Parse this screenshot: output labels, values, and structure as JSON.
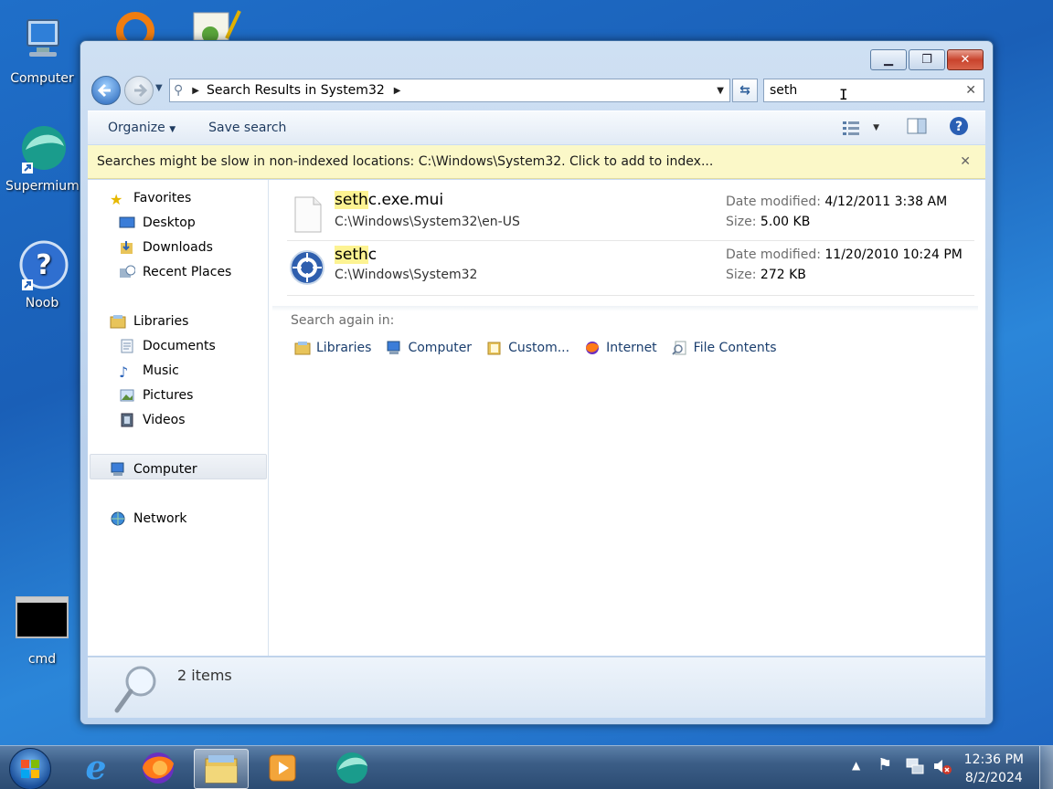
{
  "desktop": {
    "icons": [
      {
        "label": "Computer"
      },
      {
        "label": "Supermium"
      },
      {
        "label": "Noob"
      },
      {
        "label": "cmd"
      }
    ]
  },
  "window": {
    "address": {
      "path": "Search Results in System32"
    },
    "search": {
      "value": "seth"
    },
    "toolbar": {
      "organize": "Organize",
      "save_search": "Save search"
    },
    "infobar": {
      "text": "Searches might be slow in non-indexed locations: C:\\Windows\\System32. Click to add to index..."
    },
    "nav": {
      "favorites": "Favorites",
      "desktop": "Desktop",
      "downloads": "Downloads",
      "recent_places": "Recent Places",
      "libraries": "Libraries",
      "documents": "Documents",
      "music": "Music",
      "pictures": "Pictures",
      "videos": "Videos",
      "computer": "Computer",
      "network": "Network"
    },
    "results": [
      {
        "name_match": "seth",
        "name_rest": "c.exe.mui",
        "path": "C:\\Windows\\System32\\en-US",
        "date_label": "Date modified:",
        "date": "4/12/2011 3:38 AM",
        "size_label": "Size:",
        "size": "5.00 KB"
      },
      {
        "name_match": "seth",
        "name_rest": "c",
        "path": "C:\\Windows\\System32",
        "date_label": "Date modified:",
        "date": "11/20/2010 10:24 PM",
        "size_label": "Size:",
        "size": "272 KB"
      }
    ],
    "search_again": {
      "label": "Search again in:",
      "items": [
        "Libraries",
        "Computer",
        "Custom...",
        "Internet",
        "File Contents"
      ]
    },
    "status": {
      "count": "2 items"
    }
  },
  "taskbar": {
    "time": "12:36 PM",
    "date": "8/2/2024"
  },
  "colors": {
    "highlight": "#fdf392",
    "infobar": "#fbf8c8",
    "accent": "#2563b8"
  }
}
